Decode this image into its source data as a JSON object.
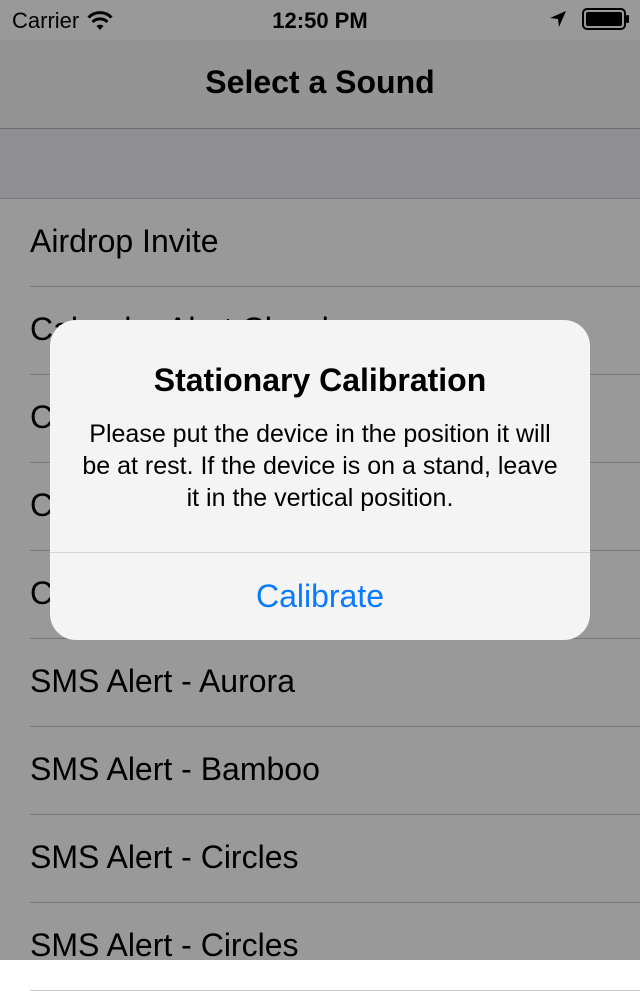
{
  "status_bar": {
    "carrier": "Carrier",
    "time": "12:50 PM",
    "icons": [
      "wifi-icon",
      "location-icon",
      "battery-icon"
    ]
  },
  "nav": {
    "title": "Select a Sound"
  },
  "list": {
    "items": [
      {
        "label": "Airdrop Invite"
      },
      {
        "label": "Calendar Alert Chord"
      },
      {
        "label": "C"
      },
      {
        "label": "C"
      },
      {
        "label": "C"
      },
      {
        "label": "SMS Alert - Aurora"
      },
      {
        "label": "SMS Alert - Bamboo"
      },
      {
        "label": "SMS Alert - Circles"
      },
      {
        "label": "SMS Alert - Circles"
      }
    ]
  },
  "alert": {
    "title": "Stationary Calibration",
    "message": "Please put the device in the position it will be at rest. If the device is on a stand, leave it in the vertical position.",
    "button_label": "Calibrate"
  },
  "colors": {
    "accent": "#0a7aff",
    "overlay": "rgba(0,0,0,0.40)"
  }
}
